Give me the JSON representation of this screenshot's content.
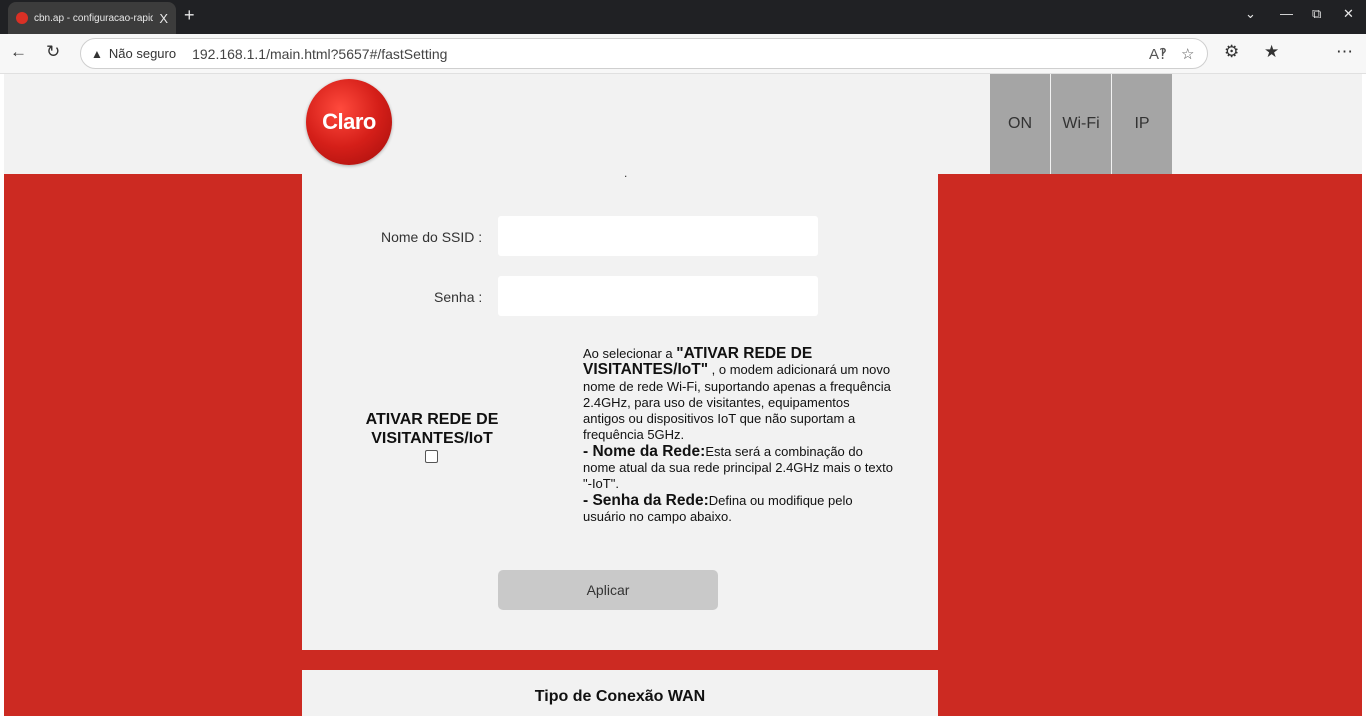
{
  "browser": {
    "tab_title": "cbn.ap - configuracao-rapida - L",
    "tab_close": "X",
    "new_tab": "+",
    "not_secure": "Não seguro",
    "url": "192.168.1.1/main.html?5657#/fastSetting"
  },
  "header": {
    "logo_text": "Claro",
    "nav": [
      "ON",
      "Wi-Fi",
      "IP"
    ]
  },
  "form": {
    "dot": ".",
    "ssid_label": "Nome do SSID",
    "ssid_value": "",
    "password_label": "Senha",
    "password_value": "",
    "guest_title": "ATIVAR REDE DE VISITANTES/IoT",
    "guest_checked": false,
    "info": {
      "intro": "Ao selecionar a ",
      "intro_bold": "\"ATIVAR REDE DE VISITANTES/IoT\"",
      "intro_rest": " , o modem adicionará um novo nome de rede Wi-Fi, suportando apenas a frequência 2.4GHz, para uso de visitantes, equipamentos antigos ou dispositivos IoT que não suportam a frequência 5GHz.",
      "name_bold": "- Nome da Rede:",
      "name_text": "Esta será a combinação do nome atual da sua rede principal 2.4GHz mais o texto \"-IoT\".",
      "pass_bold": "- Senha da Rede:",
      "pass_text": "Defina ou modifique pelo usuário no campo abaixo."
    },
    "apply_label": "Aplicar"
  },
  "wan": {
    "title": "Tipo de Conexão WAN"
  },
  "colors": {
    "brand_red": "#cc2a22",
    "panel_gray": "#f2f2f2",
    "nav_gray": "#a5a5a5"
  }
}
